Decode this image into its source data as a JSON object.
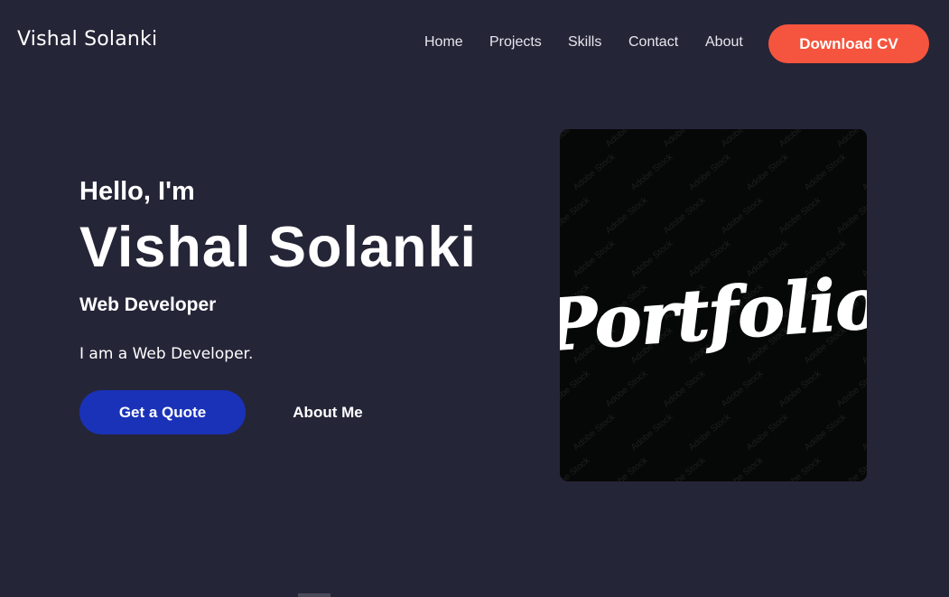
{
  "header": {
    "brand": "Vishal Solanki",
    "nav": [
      {
        "label": "Home"
      },
      {
        "label": "Projects"
      },
      {
        "label": "Skills"
      },
      {
        "label": "Contact"
      },
      {
        "label": "About"
      }
    ],
    "cta_label": "Download CV"
  },
  "hero": {
    "greeting": "Hello, I'm",
    "name": "Vishal Solanki",
    "role": "Web Developer",
    "description": "I am a Web Developer.",
    "primary_button": "Get a Quote",
    "secondary_button": "About Me"
  },
  "image": {
    "text": "Portfolio",
    "watermark": "Adobe Stock"
  },
  "colors": {
    "background": "#252538",
    "cta": "#f5553e",
    "primary_button": "#1a32b8",
    "image_background": "#060707"
  }
}
